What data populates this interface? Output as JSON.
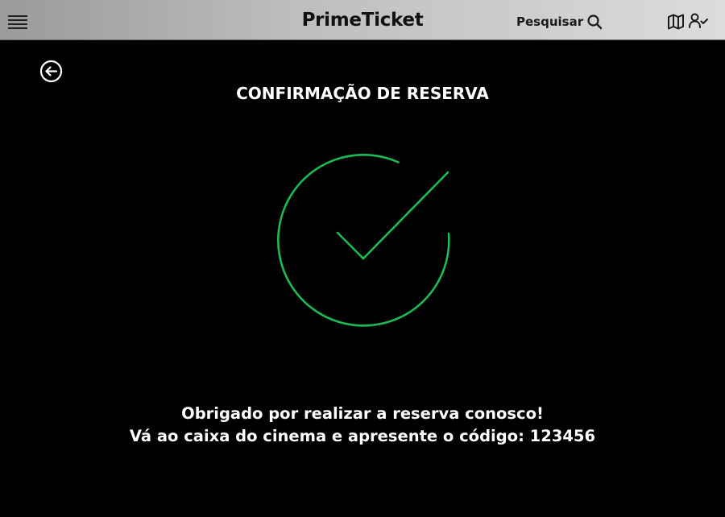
{
  "header": {
    "brand": "PrimeTicket",
    "search_label": "Pesquisar",
    "icons": {
      "menu": "hamburger-menu-icon",
      "search": "search-icon",
      "map": "map-icon",
      "user": "user-check-icon"
    }
  },
  "main": {
    "back_icon": "arrow-left-circle-icon",
    "title": "CONFIRMAÇÃO DE RESERVA",
    "success_icon": "check-circle-icon",
    "thanks": "Obrigado por realizar a reserva conosco!",
    "instruction": "Vá ao caixa do cinema e apresente o código: 123456"
  },
  "colors": {
    "background": "#000000",
    "header_gradient_start": "#9a9a9a",
    "header_gradient_end": "#dcdcdc",
    "success_green": "#1db954",
    "text": "#ffffff"
  }
}
